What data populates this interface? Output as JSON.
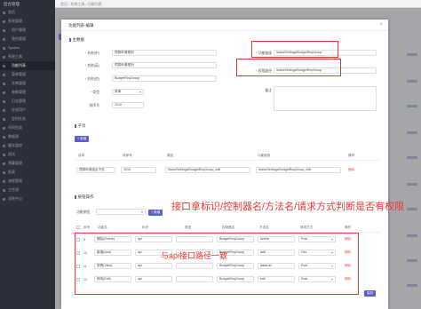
{
  "sidebar": {
    "logo": "后台管理",
    "items": [
      {
        "label": "首页"
      },
      {
        "label": "系统管理"
      },
      {
        "label": "用户管理"
      },
      {
        "label": "角色管理"
      },
      {
        "label": "System"
      },
      {
        "label": "系统工具"
      },
      {
        "label": "功能列表"
      },
      {
        "label": "菜单管理"
      },
      {
        "label": "字典管理"
      },
      {
        "label": "参数管理"
      },
      {
        "label": "日志管理"
      },
      {
        "label": "在线用户"
      },
      {
        "label": "定时任务"
      },
      {
        "label": "代码生成"
      },
      {
        "label": "数据源"
      },
      {
        "label": "缓存监控"
      },
      {
        "label": "测试"
      },
      {
        "label": "预算管理"
      },
      {
        "label": "报表"
      },
      {
        "label": "流程管理"
      },
      {
        "label": "工作流"
      },
      {
        "label": "消息中心"
      }
    ]
  },
  "topbar": {
    "breadcrumb": "首页 / 系统工具 / 功能列表"
  },
  "dialog": {
    "title": "功能列表-编辑",
    "close": "×",
    "main_section": "主数据",
    "fields": {
      "name_cn": {
        "label": "名称(中)",
        "value": "预算申请规则"
      },
      "name_en": {
        "label": "名称(英)",
        "value": "预算申请规则"
      },
      "controller": {
        "label": "名称(控)",
        "value": "BudgetReqGroup"
      },
      "type": {
        "label": "类型",
        "value": "菜单"
      },
      "sort": {
        "label": "排序号",
        "value": "1010"
      },
      "fn_link": {
        "label": "功能链接",
        "value": "/basicSettings/BudgetReqGroup"
      },
      "perm_path": {
        "label": "权限路径",
        "value": "/basicSettings/BudgetReqGroup"
      },
      "remark": {
        "label": "备注",
        "value": ""
      }
    },
    "child_section": "子页",
    "add_label": "新增",
    "child_table": {
      "headers": [
        "名称",
        "排序号",
        "路径",
        "功能链接",
        "操作"
      ],
      "rows": [
        {
          "name": "预算申请组合子页",
          "sort": "1010",
          "path": "/basicSettings/BudgetReqGroup_edit",
          "link": "/basicSettings/BudgetReqGroup_edit",
          "op": "删除"
        }
      ]
    },
    "action_section": "按钮操作",
    "action_filter_label": "功能按钮",
    "action_table": {
      "headers": [
        "序号",
        "功能名",
        "标识",
        "类型",
        "控制器名",
        "方法名",
        "请求方式",
        "操作"
      ],
      "rows": [
        {
          "no": "9",
          "name": "删除(Delete)",
          "tag": "api",
          "type": "",
          "ctrl": "BudgetReqGroup",
          "method": "delete",
          "req": "Post",
          "op": "删除"
        },
        {
          "no": "10",
          "name": "新增(Add)",
          "tag": "api",
          "type": "",
          "ctrl": "BudgetReqGroup",
          "method": "add",
          "req": "Get",
          "op": "删除"
        },
        {
          "no": "11",
          "name": "查看(View)",
          "tag": "api",
          "type": "",
          "ctrl": "BudgetReqGroup",
          "method": "dataList",
          "req": "Post",
          "op": "删除"
        },
        {
          "no": "12",
          "name": "修改(Edit)",
          "tag": "api",
          "type": "",
          "ctrl": "BudgetReqGroup",
          "method": "edit",
          "req": "Post",
          "op": "删除"
        }
      ]
    },
    "save_label": "保存"
  },
  "annotations": {
    "top": "接口拿标识/控制器名/方法名/请求方式判断是否有权限",
    "middle": "与api接口路径一致",
    "color": "#e53935"
  },
  "colors": {
    "accent": "#5b5fc7",
    "danger": "#e54d42"
  }
}
